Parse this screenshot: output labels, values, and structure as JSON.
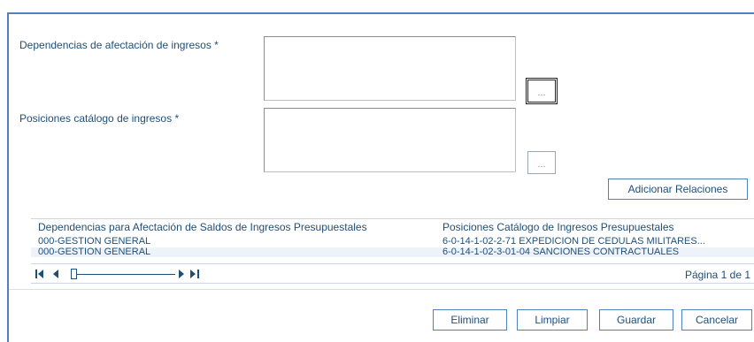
{
  "form": {
    "dependencias_label": "Dependencias de afectación de ingresos *",
    "dependencias_value": "",
    "dependencias_button": "...",
    "posiciones_label": "Posiciones catálogo de ingresos *",
    "posiciones_value": "",
    "posiciones_button": "...",
    "adicionar_label": "Adicionar Relaciones"
  },
  "grid": {
    "columns": [
      "Dependencias para Afectación de Saldos de Ingresos Presupuestales",
      "Posiciones Catálogo de Ingresos Presupuestales"
    ],
    "rows": [
      {
        "dependencia": "000-GESTION GENERAL",
        "posicion": "6-0-14-1-02-2-71 EXPEDICIÓN DE CÉDULAS MILITARES..."
      },
      {
        "dependencia": "000-GESTION GENERAL",
        "posicion": "6-0-14-1-02-3-01-04 SANCIONES CONTRACTUALES"
      }
    ],
    "pager": {
      "first_icon": "first-page-icon",
      "prev_icon": "prev-page-icon",
      "next_icon": "next-page-icon",
      "last_icon": "last-page-icon",
      "page_info": "Página 1 de 1"
    }
  },
  "actions": {
    "eliminar": "Eliminar",
    "limpiar": "Limpiar",
    "guardar": "Guardar",
    "cancelar": "Cancelar"
  },
  "colors": {
    "frame": "#4f81bd",
    "text": "#1f4e79",
    "row_alt": "#eef3f9"
  }
}
